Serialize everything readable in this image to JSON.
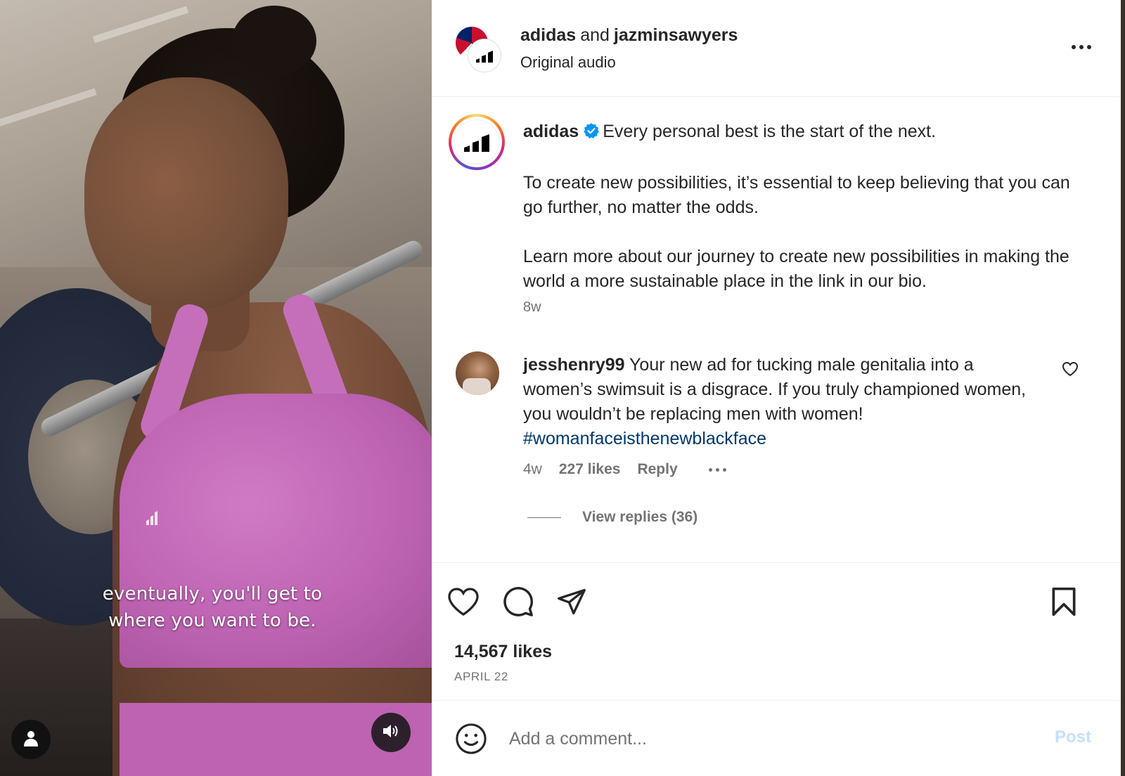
{
  "media": {
    "caption_line1": "eventually, you'll get to",
    "caption_line2": "where you want to be.",
    "icons": {
      "user": "person-icon",
      "sound": "speaker-icon"
    }
  },
  "header": {
    "account1": "adidas",
    "joiner": "and",
    "account2": "jazminsawyers",
    "audio_label": "Original audio",
    "more_icon": "more-horizontal-icon"
  },
  "caption": {
    "username": "adidas",
    "verified_icon": "verified-badge-icon",
    "line1": "Every personal best is the start of the next.",
    "para2": "To create new possibilities, it’s essential to keep believing that you can go further, no matter the odds.",
    "para3": "Learn more about our journey to create new possibilities in making the world a more sustainable place in the link in our bio.",
    "time": "8w"
  },
  "comment": {
    "username": "jesshenry99",
    "text": "Your new ad for tucking male genitalia into a women’s swimsuit is a disgrace. If you truly championed women, you wouldn’t be replacing men with women!",
    "hashtag": "#womanfaceisthenewblackface",
    "time": "4w",
    "likes": "227 likes",
    "reply_label": "Reply",
    "view_replies": "View replies (36)"
  },
  "actions": {
    "icons": [
      "heart-icon",
      "comment-icon",
      "share-icon",
      "bookmark-icon"
    ],
    "likes": "14,567 likes",
    "date": "APRIL 22"
  },
  "comment_box": {
    "placeholder": "Add a comment...",
    "post_label": "Post"
  },
  "colors": {
    "text": "#262626",
    "secondary": "#737373",
    "link": "#00376b",
    "verified": "#0095f6",
    "post_disabled": "#c6e0fb"
  }
}
